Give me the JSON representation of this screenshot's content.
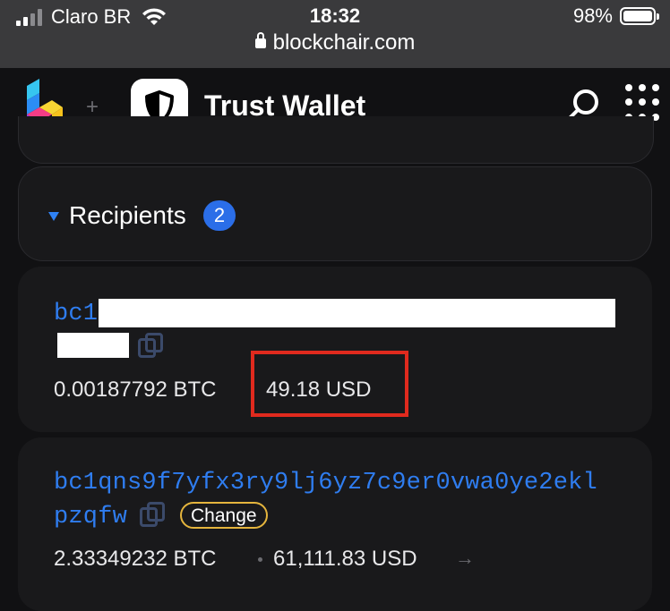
{
  "status_bar": {
    "carrier": "Claro BR",
    "time": "18:32",
    "battery": "98%",
    "url": "blockchair.com"
  },
  "app_bar": {
    "title": "Trust Wallet",
    "separator": "+"
  },
  "recipients": {
    "label": "Recipients",
    "count": "2"
  },
  "outputs": [
    {
      "address_start": "bc1",
      "btc": "0.00187792 BTC",
      "usd": "49.18 USD"
    },
    {
      "address_line1": "bc1qns9f7yfx3ry9lj6yz7c9er0vwa0ye2ekl",
      "address_line2": "pzqfw",
      "tag": "Change",
      "btc": "2.33349232 BTC",
      "usd": "61,111.83 USD",
      "arrow": "→"
    }
  ],
  "colors": {
    "accent_blue": "#2f7df0",
    "highlight_red": "#e02a1e",
    "change_gold": "#e5b53d"
  }
}
